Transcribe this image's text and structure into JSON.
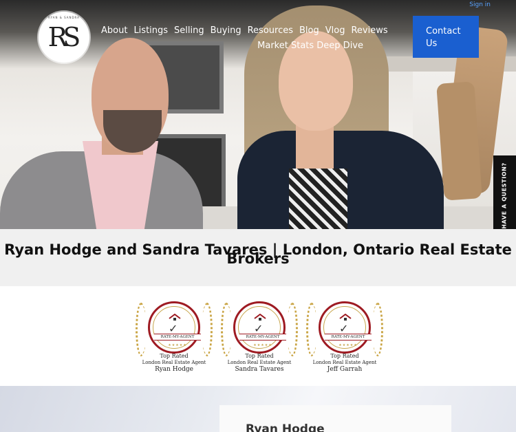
{
  "header": {
    "logo_text": "RS",
    "logo_sub": "RYAN & SANDRA",
    "nav": [
      "About",
      "Listings",
      "Selling",
      "Buying",
      "Resources",
      "Blog",
      "Vlog",
      "Reviews",
      "Market Stats Deep Dive"
    ],
    "sign_in": "Sign in",
    "contact": "Contact Us"
  },
  "side_tab": "HAVE A QUESTION?",
  "page_title": "Ryan Hodge and Sandra Tavares | London, Ontario Real Estate Brokers",
  "badges": [
    {
      "ribbon": "RATE-MY-AGENT",
      "line1": "Top Rated",
      "line2": "London Real Estate Agent",
      "name": "Ryan Hodge"
    },
    {
      "ribbon": "RATE-MY-AGENT",
      "line1": "Top Rated",
      "line2": "London Real Estate Agent",
      "name": "Sandra Tavares"
    },
    {
      "ribbon": "RATE-MY-AGENT",
      "line1": "Top Rated",
      "line2": "London Real Estate Agent",
      "name": "Jeff Garrah"
    }
  ],
  "profile": {
    "name": "Ryan Hodge"
  },
  "colors": {
    "accent": "#1a5fd0",
    "badge_red": "#9e1b22",
    "badge_gold": "#c9a443"
  }
}
